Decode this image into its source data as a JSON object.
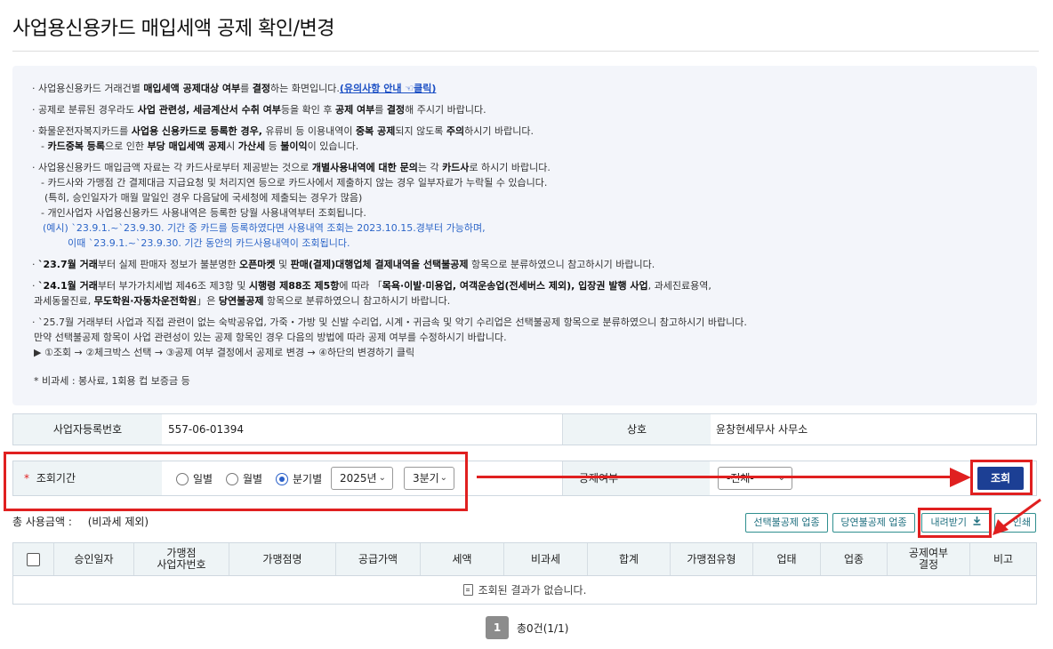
{
  "page_title": "사업용신용카드 매입세액 공제 확인/변경",
  "notice": {
    "l1_pre": "사업용신용카드 거래건별 ",
    "l1_bold": "매입세액 공제대상 여부",
    "l1_mid": "를 ",
    "l1_bold2": "결정",
    "l1_post": "하는 화면입니다.",
    "l1_link": "(유의사항 안내 ☜클릭)",
    "l2_pre": "공제로 분류된 경우라도 ",
    "l2_bold": "사업 관련성, 세금계산서 수취 여부",
    "l2_mid": "등을 확인 후 ",
    "l2_bold2": "공제 여부",
    "l2_mid2": "를 ",
    "l2_bold3": "결정",
    "l2_post": "해 주시기 바랍니다.",
    "l3_pre": "화물운전자복지카드를 ",
    "l3_bold": "사업용 신용카드로 등록한 경우,",
    "l3_mid": " 유류비 등 이용내역이 ",
    "l3_bold2": "중복 공제",
    "l3_mid2": "되지 않도록 ",
    "l3_bold3": "주의",
    "l3_post": "하시기 바랍니다.",
    "l4_pre": "- ",
    "l4_bold": "카드중복 등록",
    "l4_mid": "으로 인한 ",
    "l4_bold2": "부당 매입세액 공제",
    "l4_mid2": "시 ",
    "l4_bold3": "가산세",
    "l4_mid3": " 등 ",
    "l4_bold4": "불이익",
    "l4_post": "이 있습니다.",
    "l5_pre": "사업용신용카드 매입금액 자료는 각 카드사로부터 제공받는 것으로 ",
    "l5_bold": "개별사용내역에 대한 문의",
    "l5_mid": "는 각 ",
    "l5_bold2": "카드사",
    "l5_post": "로 하시기 바랍니다.",
    "l6": "- 카드사와 가맹점 간 결제대금 지급요청 및 처리지연 등으로 카드사에서 제출하지 않는 경우 일부자료가 누락될 수 있습니다.",
    "l7": "(특히, 승인일자가 매월 말일인 경우 다음달에 국세청에 제출되는 경우가 많음)",
    "l8": "- 개인사업자 사업용신용카드 사용내역은 등록한 당월 사용내역부터 조회됩니다.",
    "l9": "(예시) `23.9.1.~`23.9.30. 기간 중 카드를 등록하였다면 사용내역 조회는 2023.10.15.경부터 가능하며,",
    "l10": "이때 `23.9.1.~`23.9.30. 기간 동안의 카드사용내역이 조회됩니다.",
    "l11_bold": "`23.7월 거래",
    "l11_mid": "부터 실제 판매자 정보가 불분명한 ",
    "l11_bold2": "오픈마켓",
    "l11_mid2": " 및 ",
    "l11_bold3": "판매(결제)대행업체 결제내역을 선택불공제",
    "l11_post": " 항목으로 분류하였으니 참고하시기 바랍니다.",
    "l12_bold": "`24.1월 거래",
    "l12_mid": "부터 부가가치세법 제46조 제3항 및 ",
    "l12_bold2": "시행령 제88조 제5항",
    "l12_mid2": "에 따라 「",
    "l12_bold3": "목욕·이발·미용업, 여객운송업(전세버스 제외), 입장권 발행 사업",
    "l12_post": ", 과세진료용역,",
    "l13_pre": "과세동물진료, ",
    "l13_bold": "무도학원·자동차운전학원",
    "l13_mid": "」은 ",
    "l13_bold2": "당연불공제",
    "l13_post": " 항목으로 분류하였으니 참고하시기 바랍니다.",
    "l14": "`25.7월 거래부터 사업과 직접 관련이 없는 숙박공유업, 가죽・가방 및 신발 수리업, 시계・귀금속 및 악기 수리업은 선택불공제 항목으로 분류하였으니 참고하시기 바랍니다.",
    "l15": "만약 선택불공제 항목이 사업 관련성이 있는 공제 항목인 경우 다음의 방법에 따라 공제 여부를 수정하시기 바랍니다.",
    "l16": "▶ ①조회 → ②체크박스 선택 → ③공제 여부 결정에서 공제로 변경 → ④하단의 변경하기 클릭",
    "l17": "* 비과세 : 봉사료, 1회용 컵 보증금 등"
  },
  "biz": {
    "reg_label": "사업자등록번호",
    "reg_value": "557-06-01394",
    "name_label": "상호",
    "name_value": "윤창현세무사 사무소"
  },
  "search": {
    "required_mark": "*",
    "period_label": "조회기간",
    "radio_daily": "일별",
    "radio_monthly": "월별",
    "radio_quarterly": "분기별",
    "selected_radio": "분기별",
    "year_value": "2025년",
    "quarter_value": "3분기",
    "deduct_label": "공제여부",
    "deduct_value": "-전체-",
    "search_button": "조회"
  },
  "summary": {
    "total_label": "총 사용금액 :",
    "total_note": "(비과세 제외)",
    "btn_select_nondeduct": "선택불공제 업종",
    "btn_auto_nondeduct": "당연불공제 업종",
    "btn_download": "내려받기",
    "btn_print": "인쇄"
  },
  "table": {
    "columns": [
      "승인일자",
      "가맹점\n사업자번호",
      "가맹점명",
      "공급가액",
      "세액",
      "비과세",
      "합계",
      "가맹점유형",
      "업태",
      "업종",
      "공제여부\n결정",
      "비고"
    ],
    "empty_message": "조회된 결과가 없습니다."
  },
  "pagination": {
    "current_page": "1",
    "info": "총0건(1/1)"
  },
  "colors": {
    "accent": "#1c3f94",
    "header_bg": "#eef4f6",
    "annotation_red": "#e02020",
    "notice_bg": "#f3f5fa"
  }
}
